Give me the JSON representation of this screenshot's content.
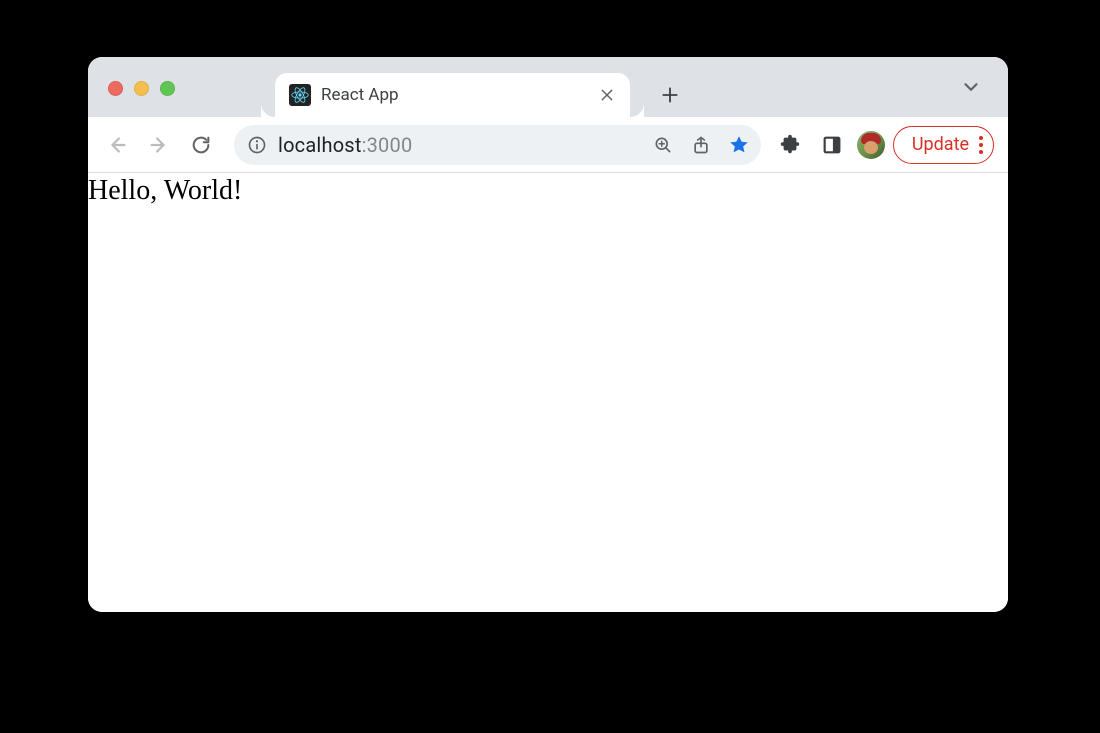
{
  "tab": {
    "title": "React App",
    "favicon": "react-logo"
  },
  "address": {
    "host": "localhost",
    "port": ":3000"
  },
  "toolbar": {
    "update_label": "Update"
  },
  "page": {
    "body_text": "Hello, World!"
  }
}
